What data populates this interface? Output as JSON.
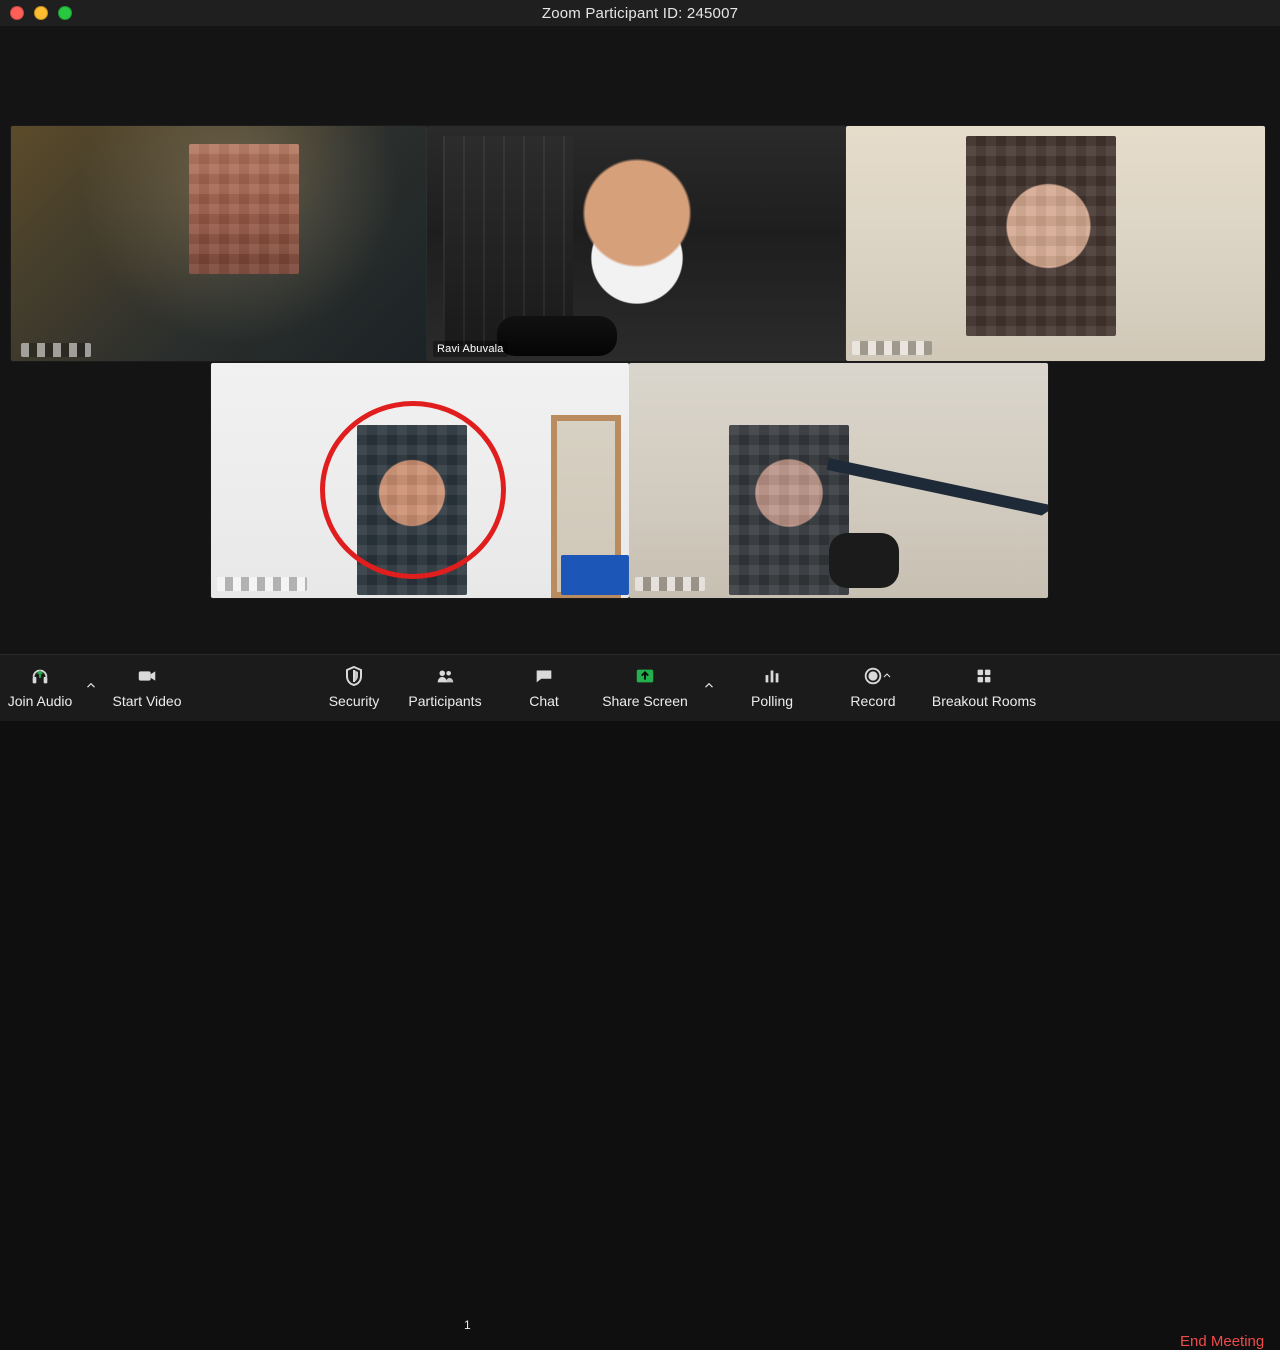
{
  "window": {
    "title": "Zoom Participant ID: 245007"
  },
  "participants": {
    "tile_2_name": "Ravi Abuvala"
  },
  "toolbar": {
    "join_audio": "Join Audio",
    "start_video": "Start Video",
    "security": "Security",
    "participants": "Participants",
    "participants_count": "1",
    "chat": "Chat",
    "share_screen": "Share Screen",
    "polling": "Polling",
    "record": "Record",
    "breakout_rooms": "Breakout Rooms",
    "end_meeting": "End Meeting"
  },
  "colors": {
    "accent_green": "#22b14c",
    "end_meeting_red": "#f04a4a",
    "highlight_circle_red": "#e11e1e"
  }
}
